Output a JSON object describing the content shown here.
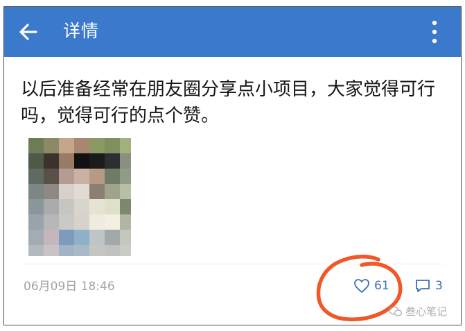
{
  "header": {
    "title": "详情",
    "back_icon": "arrow-left-icon",
    "more_icon": "more-vertical-icon",
    "background": "#3b79cc"
  },
  "post": {
    "text": "以后准备经常在朋友圈分享点小项目，大家觉得可行吗，觉得可行的点个赞。",
    "timestamp": "06月09日 18:46",
    "likes": "61",
    "comments": "3"
  },
  "watermark": {
    "text": "叁心笔记",
    "icon": "wechat-logo-icon"
  },
  "colors": {
    "accent": "#3a6fb8",
    "annotation": "#f0582a",
    "timestamp": "#a3a3a3"
  }
}
